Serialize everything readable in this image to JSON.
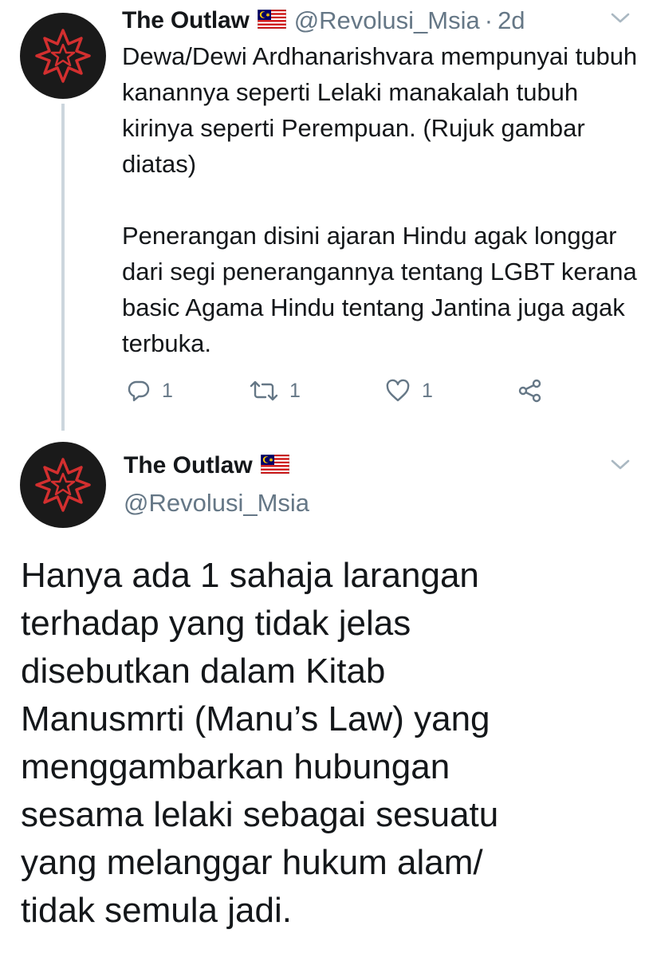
{
  "tweet_1": {
    "display_name": "The Outlaw",
    "handle": "@Revolusi_Msia",
    "separator": "·",
    "time": "2d",
    "body_paragraphs": [
      "Dewa/Dewi Ardhanarishvara mempunyai tubuh kanannya seperti Lelaki manakalah tubuh kirinya seperti Perempuan. (Rujuk gambar diatas)",
      "Penerangan disini ajaran Hindu agak longgar dari segi penerangannya tentang LGBT kerana basic Agama Hindu tentang Jantina juga agak terbuka."
    ],
    "actions": {
      "reply_count": "1",
      "retweet_count": "1",
      "like_count": "1"
    }
  },
  "tweet_2": {
    "display_name": "The Outlaw",
    "handle": "@Revolusi_Msia",
    "body_lines": [
      "Hanya ada 1 sahaja larangan",
      "terhadap yang tidak jelas",
      "disebutkan dalam Kitab",
      "Manusmrti (Manu’s Law) yang",
      "menggambarkan hubungan",
      "sesama lelaki sebagai sesuatu",
      "yang melanggar hukum alam/",
      "tidak semula jadi."
    ]
  },
  "icons": {
    "flag": "malaysia-flag-icon",
    "reply": "reply-icon",
    "retweet": "retweet-icon",
    "like": "heart-icon",
    "share": "share-icon",
    "more": "chevron-down-icon",
    "avatar": "star-emblem-avatar"
  },
  "colors": {
    "text": "#14171a",
    "secondary": "#657786",
    "thread_line": "#ccd6dd",
    "avatar_bg": "#1a1a1a",
    "avatar_emblem": "#d32f2f"
  }
}
